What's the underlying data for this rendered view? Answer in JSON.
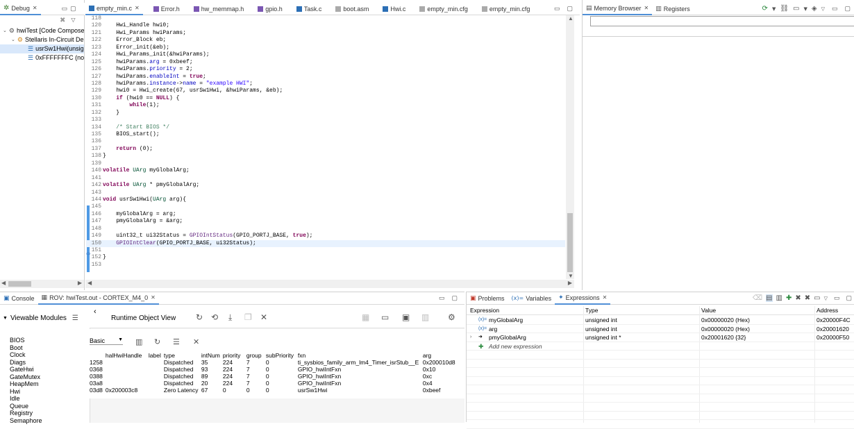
{
  "debug": {
    "tab": "Debug",
    "tree": [
      {
        "label": "hwiTest [Code Compose",
        "indent": 4,
        "icon": "debug-launch-icon"
      },
      {
        "label": "Stellaris In-Circuit De",
        "indent": 16,
        "icon": "target-icon"
      },
      {
        "label": "usrSw1Hwi(unsig",
        "indent": 40,
        "icon": "stack-frame-icon",
        "selected": true
      },
      {
        "label": "0xFFFFFFFC  (no s",
        "indent": 40,
        "icon": "stack-frame-icon"
      }
    ]
  },
  "editor": {
    "tabs": [
      "empty_min.c",
      "Error.h",
      "hw_memmap.h",
      "gpio.h",
      "Task.c",
      "boot.asm",
      "Hwi.c",
      "empty_min.cfg",
      "empty_min.cfg"
    ],
    "lines": [
      {
        "n": "118",
        "t": ""
      },
      {
        "n": "120",
        "t": "    Hwi_Handle hwi0;"
      },
      {
        "n": "121",
        "t": "    Hwi_Params hwiParams;"
      },
      {
        "n": "122",
        "t": "    Error_Block eb;"
      },
      {
        "n": "123",
        "t": "    Error_init(&eb);"
      },
      {
        "n": "124",
        "t": "    Hwi_Params_init(&hwiParams);"
      },
      {
        "n": "125",
        "t": "    hwiParams.arg = 0xbeef;"
      },
      {
        "n": "126",
        "t": "    hwiParams.priority = 2;"
      },
      {
        "n": "127",
        "t": "    hwiParams.enableInt = true;"
      },
      {
        "n": "128",
        "t": "    hwiParams.instance->name = \"example HWI\";"
      },
      {
        "n": "129",
        "t": "    hwi0 = Hwi_create(67, usrSw1Hwi, &hwiParams, &eb);"
      },
      {
        "n": "130",
        "t": "    if (hwi0 == NULL) {"
      },
      {
        "n": "131",
        "t": "        while(1);"
      },
      {
        "n": "132",
        "t": "    }"
      },
      {
        "n": "133",
        "t": ""
      },
      {
        "n": "134",
        "t": "    /* Start BIOS */"
      },
      {
        "n": "135",
        "t": "    BIOS_start();"
      },
      {
        "n": "136",
        "t": ""
      },
      {
        "n": "137",
        "t": "    return (0);"
      },
      {
        "n": "138",
        "t": "}"
      },
      {
        "n": "139",
        "t": ""
      },
      {
        "n": "140",
        "t": "volatile UArg myGlobalArg;"
      },
      {
        "n": "141",
        "t": ""
      },
      {
        "n": "142",
        "t": "volatile UArg * pmyGlobalArg;"
      },
      {
        "n": "143",
        "t": ""
      },
      {
        "n": "144",
        "t": "void usrSw1Hwi(UArg arg){"
      },
      {
        "n": "145",
        "t": ""
      },
      {
        "n": "146",
        "t": "    myGlobalArg = arg;"
      },
      {
        "n": "147",
        "t": "    pmyGlobalArg = &arg;"
      },
      {
        "n": "148",
        "t": ""
      },
      {
        "n": "149",
        "t": "    uint32_t ui32Status = GPIOIntStatus(GPIO_PORTJ_BASE, true);"
      },
      {
        "n": "150",
        "t": "    GPIOIntClear(GPIO_PORTJ_BASE, ui32Status);"
      },
      {
        "n": "151",
        "t": ""
      },
      {
        "n": "152",
        "t": "}"
      },
      {
        "n": "153",
        "t": ""
      }
    ]
  },
  "memory": {
    "tabs": [
      "Memory Browser",
      "Registers"
    ]
  },
  "bottom_left": {
    "tabs": [
      "Console",
      "ROV: hwiTest.out - CORTEX_M4_0"
    ],
    "viewable_modules": "Viewable Modules",
    "runtime_object_view": "Runtime Object View",
    "view_mode": "Basic",
    "modules": [
      "BIOS",
      "Boot",
      "Clock",
      "Diags",
      "GateHwi",
      "GateMutex",
      "HeapMem",
      "Hwi",
      "Idle",
      "Queue",
      "Registry",
      "Semaphore"
    ],
    "columns": [
      "",
      "halHwiHandle",
      "label",
      "type",
      "intNum",
      "priority",
      "group",
      "subPriority",
      "fxn",
      "arg"
    ],
    "rows": [
      [
        "1258",
        "",
        "",
        "Dispatched",
        "35",
        "224",
        "7",
        "0",
        "ti_sysbios_family_arm_lm4_Timer_isrStub__E",
        "0x200010d8"
      ],
      [
        "0368",
        "",
        "",
        "Dispatched",
        "93",
        "224",
        "7",
        "0",
        "GPIO_hwiIntFxn",
        "0x10"
      ],
      [
        "0388",
        "",
        "",
        "Dispatched",
        "89",
        "224",
        "7",
        "0",
        "GPIO_hwiIntFxn",
        "0xc"
      ],
      [
        "03a8",
        "",
        "",
        "Dispatched",
        "20",
        "224",
        "7",
        "0",
        "GPIO_hwiIntFxn",
        "0x4"
      ],
      [
        "03d8",
        "0x200003c8",
        "",
        "Zero Latency",
        "67",
        "0",
        "0",
        "0",
        "usrSw1Hwi",
        "0xbeef"
      ]
    ]
  },
  "expressions": {
    "tabs": [
      "Problems",
      "Variables",
      "Expressions"
    ],
    "columns": [
      "Expression",
      "Type",
      "Value",
      "Address"
    ],
    "rows": [
      {
        "name": "myGlobalArg",
        "type": "unsigned int",
        "value": "0x00000020 (Hex)",
        "address": "0x20000F4C"
      },
      {
        "name": "arg",
        "type": "unsigned int",
        "value": "0x00000020 (Hex)",
        "address": "0x20001620"
      },
      {
        "name": "pmyGlobalArg",
        "type": "unsigned int *",
        "value": "0x20001620 {32}",
        "address": "0x20000F50"
      }
    ],
    "add_new": "Add new expression"
  }
}
